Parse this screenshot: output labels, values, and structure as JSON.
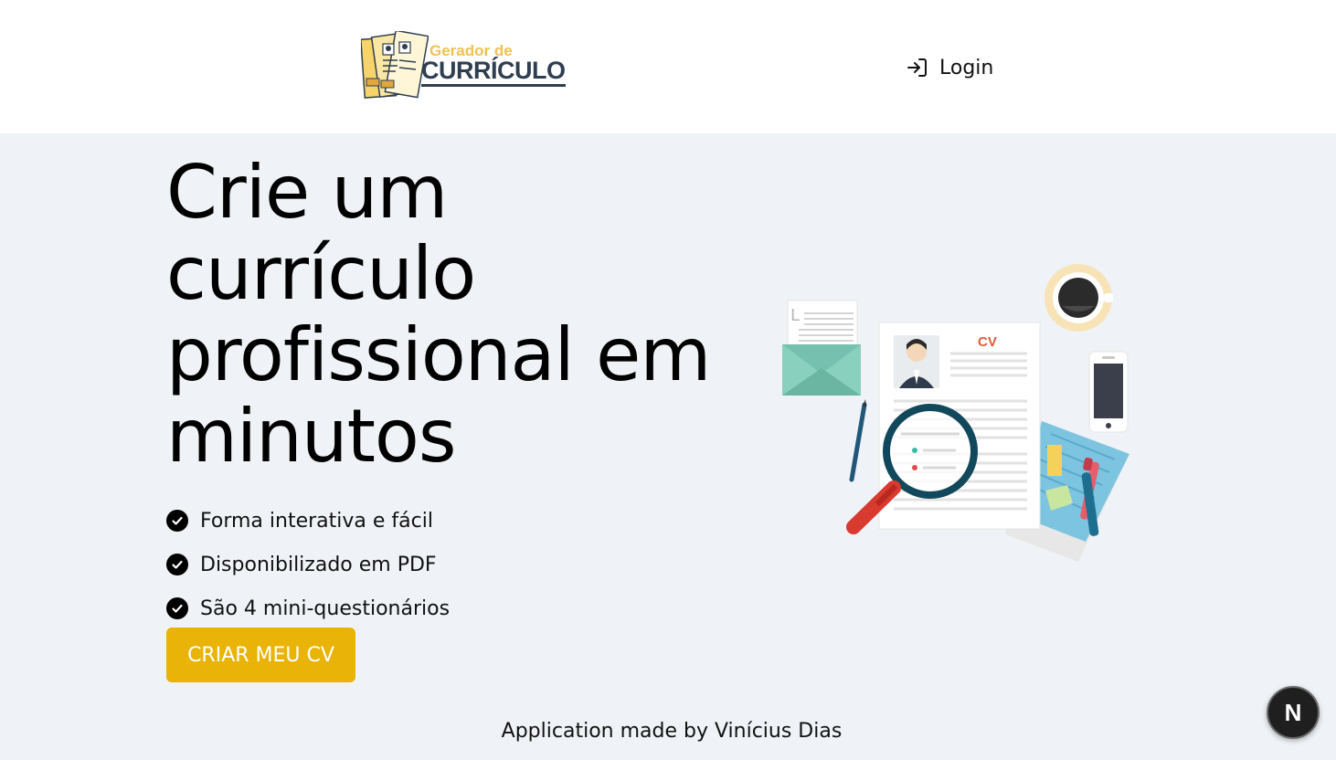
{
  "header": {
    "logo": {
      "line1": "Gerador de",
      "line2": "CURRÍCULO"
    },
    "login_label": "Login"
  },
  "hero": {
    "title": "Crie um currículo profissional em minutos",
    "features": [
      "Forma interativa e fácil",
      "Disponibilizado em PDF",
      "São 4 mini-questionários"
    ],
    "cta_label": "CRIAR MEU CV",
    "illustration": {
      "cv_label": "CV",
      "envelope_letter": "L"
    }
  },
  "footer": {
    "text": "Application made by Vinícius Dias"
  },
  "dev_badge": {
    "label": "N"
  },
  "colors": {
    "accent": "#e9b308",
    "page_bg": "#eff3f7",
    "header_bg": "#ffffff",
    "logo_yellow": "#efc24f",
    "logo_navy": "#2f3e50"
  }
}
